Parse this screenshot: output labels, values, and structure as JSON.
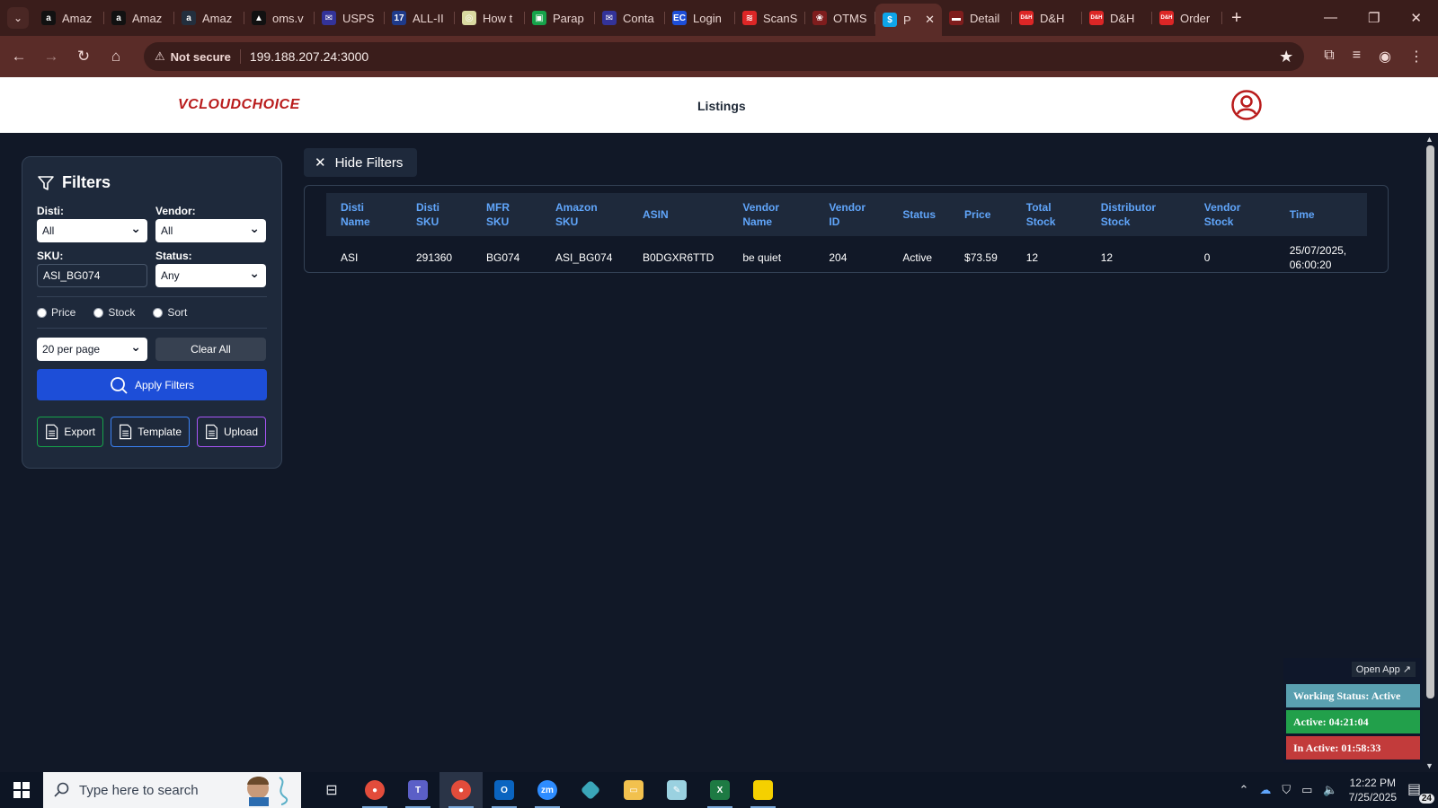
{
  "browser": {
    "tabs": [
      {
        "label": "Amaz",
        "icon": "amazon-icon",
        "color": "#111111",
        "glyph": "a"
      },
      {
        "label": "Amaz",
        "icon": "amazon-icon",
        "color": "#111111",
        "glyph": "a"
      },
      {
        "label": "Amaz",
        "icon": "amazon-icon",
        "color": "#232f3e",
        "glyph": "a"
      },
      {
        "label": "oms.v",
        "icon": "triangle-icon",
        "color": "#111111",
        "glyph": "▲"
      },
      {
        "label": "USPS",
        "icon": "usps-icon",
        "color": "#333399",
        "glyph": "✉"
      },
      {
        "label": "ALL-II",
        "icon": "seventeen-icon",
        "color": "#1e3a8a",
        "glyph": "17"
      },
      {
        "label": "How t",
        "icon": "chatgpt-icon",
        "color": "#d9d9a0",
        "glyph": "◎"
      },
      {
        "label": "Parap",
        "icon": "bag-icon",
        "color": "#16a34a",
        "glyph": "▣"
      },
      {
        "label": "Conta",
        "icon": "usps-icon",
        "color": "#333399",
        "glyph": "✉"
      },
      {
        "label": "Login",
        "icon": "ec-icon",
        "color": "#1d4ed8",
        "glyph": "EC"
      },
      {
        "label": "ScanS",
        "icon": "stack-icon",
        "color": "#dc2626",
        "glyph": "≋"
      },
      {
        "label": "OTMS",
        "icon": "otms-icon",
        "color": "#7f1d1d",
        "glyph": "❀"
      },
      {
        "label": "P",
        "icon": "dollar-icon",
        "color": "#0ea5e9",
        "glyph": "$",
        "active": true
      },
      {
        "label": "Detail",
        "icon": "flag-icon",
        "color": "#7f1d1d",
        "glyph": "▬"
      },
      {
        "label": "D&H",
        "icon": "dh-icon",
        "color": "#dc2626",
        "glyph": "D&H"
      },
      {
        "label": "D&H",
        "icon": "dh-icon",
        "color": "#dc2626",
        "glyph": "D&H"
      },
      {
        "label": "Order",
        "icon": "dh-icon",
        "color": "#dc2626",
        "glyph": "D&H"
      }
    ],
    "not_secure": "Not secure",
    "url": "199.188.207.24:3000"
  },
  "header": {
    "logo_text": "VCLOUDCHOICE",
    "title": "Listings"
  },
  "filters": {
    "title": "Filters",
    "disti_label": "Disti:",
    "disti_value": "All",
    "vendor_label": "Vendor:",
    "vendor_value": "All",
    "sku_label": "SKU:",
    "sku_value": "ASI_BG074",
    "status_label": "Status:",
    "status_value": "Any",
    "radio_price": "Price",
    "radio_stock": "Stock",
    "radio_sort": "Sort",
    "per_page": "20 per page",
    "clear_all": "Clear All",
    "apply": "Apply Filters",
    "export": "Export",
    "template": "Template",
    "upload": "Upload"
  },
  "hide_filters": "Hide Filters",
  "table": {
    "columns": [
      "Disti Name",
      "Disti SKU",
      "MFR SKU",
      "Amazon SKU",
      "ASIN",
      "Vendor Name",
      "Vendor ID",
      "Status",
      "Price",
      "Total Stock",
      "Distributor Stock",
      "Vendor Stock",
      "Time"
    ],
    "rows": [
      [
        "ASI",
        "291360",
        "BG074",
        "ASI_BG074",
        "B0DGXR6TTD",
        "be quiet",
        "204",
        "Active",
        "$73.59",
        "12",
        "12",
        "0",
        "25/07/2025, 06:00:20"
      ]
    ]
  },
  "widget": {
    "open_app": "Open App ↗",
    "working_status": "Working Status: Active",
    "active": "Active: 04:21:04",
    "inactive": "In Active: 01:58:33"
  },
  "taskbar": {
    "search_placeholder": "Type here to search",
    "time": "12:22 PM",
    "date": "7/25/2025",
    "notifications": "24"
  },
  "colors": {
    "accent_blue": "#1d4ed8",
    "header_text_blue": "#60a5fa",
    "brand_red": "#b91c1c"
  }
}
